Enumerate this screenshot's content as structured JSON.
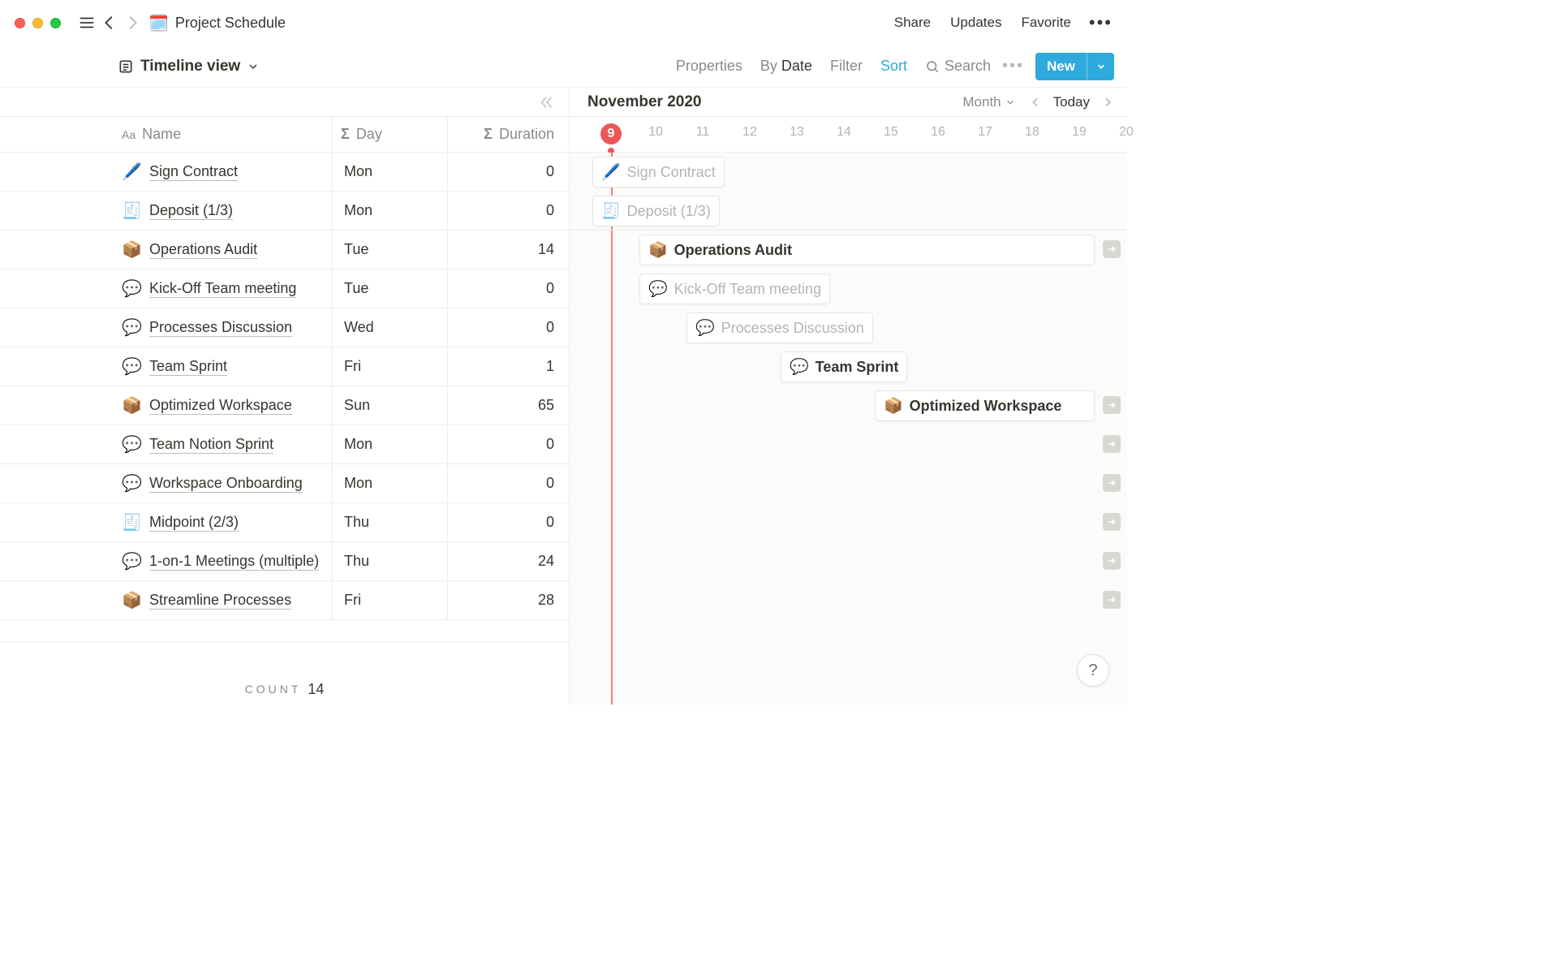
{
  "header": {
    "page_icon": "🗓️",
    "page_title": "Project Schedule",
    "links": [
      "Share",
      "Updates",
      "Favorite"
    ]
  },
  "toolbar": {
    "view_name": "Timeline view",
    "properties": "Properties",
    "groupby_prefix": "By",
    "groupby_value": "Date",
    "filter": "Filter",
    "sort": "Sort",
    "search": "Search",
    "new": "New"
  },
  "table": {
    "columns": {
      "name": "Name",
      "day": "Day",
      "duration": "Duration"
    },
    "rows": [
      {
        "icon": "🖊️",
        "name": "Sign Contract",
        "day": "Mon",
        "duration": 0
      },
      {
        "icon": "🧾",
        "name": "Deposit (1/3)",
        "day": "Mon",
        "duration": 0
      },
      {
        "icon": "📦",
        "name": "Operations Audit",
        "day": "Tue",
        "duration": 14
      },
      {
        "icon": "💬",
        "name": "Kick-Off Team meeting",
        "day": "Tue",
        "duration": 0
      },
      {
        "icon": "💬",
        "name": "Processes Discussion",
        "day": "Wed",
        "duration": 0
      },
      {
        "icon": "💬",
        "name": "Team Sprint",
        "day": "Fri",
        "duration": 1
      },
      {
        "icon": "📦",
        "name": "Optimized Workspace",
        "day": "Sun",
        "duration": 65
      },
      {
        "icon": "💬",
        "name": "Team Notion Sprint",
        "day": "Mon",
        "duration": 0
      },
      {
        "icon": "💬",
        "name": "Workspace Onboarding",
        "day": "Mon",
        "duration": 0
      },
      {
        "icon": "🧾",
        "name": "Midpoint (2/3)",
        "day": "Thu",
        "duration": 0
      },
      {
        "icon": "💬",
        "name": "1-on-1 Meetings (multiple)",
        "day": "Thu",
        "duration": 24
      },
      {
        "icon": "📦",
        "name": "Streamline Processes",
        "day": "Fri",
        "duration": 28
      }
    ],
    "count_label": "COUNT",
    "count_value": 14
  },
  "timeline": {
    "title": "November 2020",
    "scale_label": "Month",
    "today_label": "Today",
    "today_day": 9,
    "days": [
      9,
      10,
      11,
      12,
      13,
      14,
      15,
      16,
      17,
      18,
      19,
      20
    ],
    "bars": [
      {
        "icon": "🖊️",
        "label": "Sign Contract",
        "start": 9,
        "len": 1,
        "ghost": true,
        "strong": false,
        "arrow": false
      },
      {
        "icon": "🧾",
        "label": "Deposit (1/3)",
        "start": 9,
        "len": 1,
        "ghost": true,
        "strong": false,
        "arrow": false
      },
      {
        "icon": "📦",
        "label": "Operations Audit",
        "start": 10,
        "len": 14,
        "ghost": false,
        "strong": true,
        "arrow": true
      },
      {
        "icon": "💬",
        "label": "Kick-Off Team meeting",
        "start": 10,
        "len": 1,
        "ghost": true,
        "strong": false,
        "arrow": false
      },
      {
        "icon": "💬",
        "label": "Processes Discussion",
        "start": 11,
        "len": 1,
        "ghost": true,
        "strong": false,
        "arrow": false
      },
      {
        "icon": "💬",
        "label": "Team Sprint",
        "start": 13,
        "len": 2,
        "ghost": false,
        "strong": true,
        "arrow": false
      },
      {
        "icon": "📦",
        "label": "Optimized Workspace",
        "start": 15,
        "len": 65,
        "ghost": false,
        "strong": true,
        "arrow": true
      },
      {
        "icon": "",
        "label": "",
        "start": 30,
        "len": 1,
        "ghost": false,
        "strong": false,
        "arrow": true
      },
      {
        "icon": "",
        "label": "",
        "start": 30,
        "len": 1,
        "ghost": false,
        "strong": false,
        "arrow": true
      },
      {
        "icon": "",
        "label": "",
        "start": 30,
        "len": 1,
        "ghost": false,
        "strong": false,
        "arrow": true
      },
      {
        "icon": "",
        "label": "",
        "start": 30,
        "len": 1,
        "ghost": false,
        "strong": false,
        "arrow": true
      },
      {
        "icon": "",
        "label": "",
        "start": 30,
        "len": 1,
        "ghost": false,
        "strong": false,
        "arrow": true
      }
    ]
  },
  "help": "?"
}
